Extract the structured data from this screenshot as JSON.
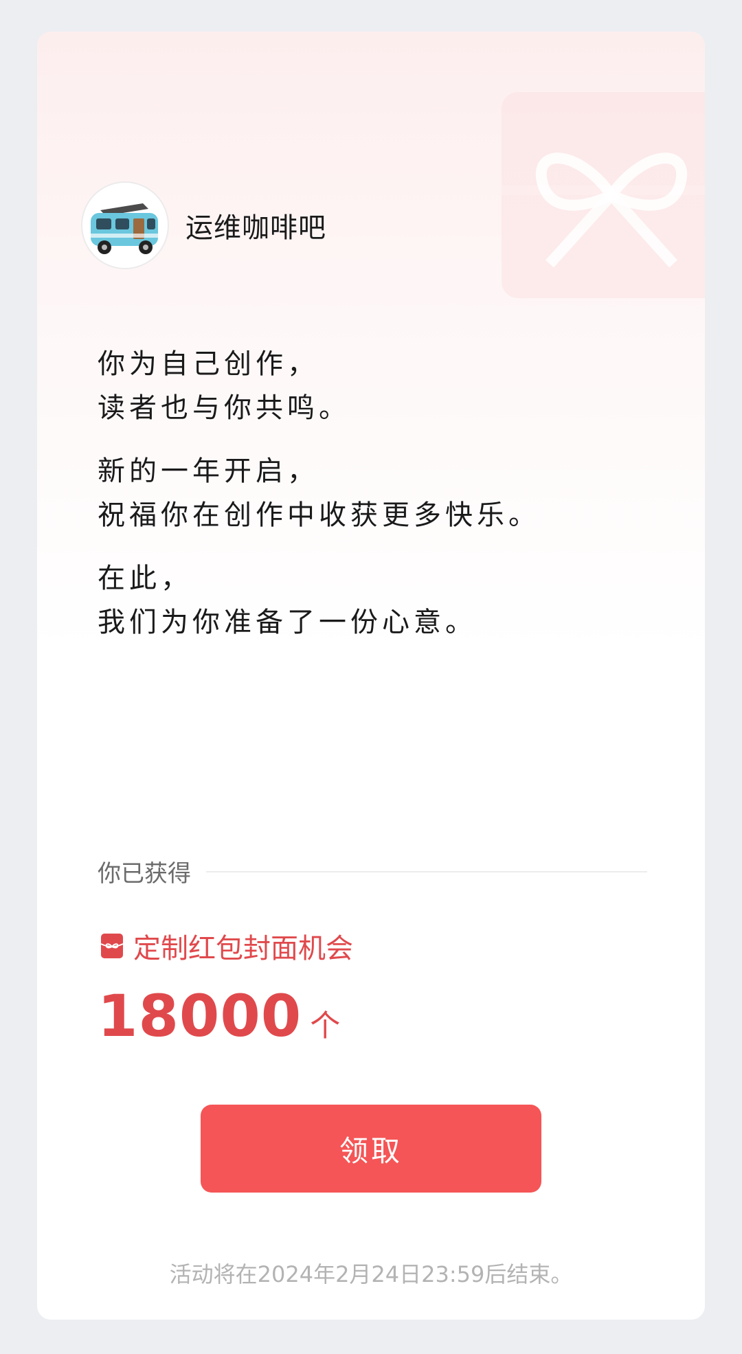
{
  "account": {
    "name": "运维咖啡吧",
    "avatar_icon": "camper-van-icon"
  },
  "message": {
    "paragraphs": [
      [
        "你为自己创作，",
        "读者也与你共鸣。"
      ],
      [
        "新的一年开启，",
        "祝福你在创作中收获更多快乐。"
      ],
      [
        "在此，",
        "我们为你准备了一份心意。"
      ]
    ]
  },
  "reward": {
    "section_label": "你已获得",
    "icon": "red-envelope-icon",
    "title": "定制红包封面机会",
    "count": "18000",
    "unit": "个"
  },
  "actions": {
    "claim_label": "领取"
  },
  "footer": {
    "note": "活动将在2024年2月24日23:59后结束。"
  },
  "colors": {
    "accent": "#f55556",
    "accent_text": "#e0494c",
    "background": "#eceef2"
  }
}
